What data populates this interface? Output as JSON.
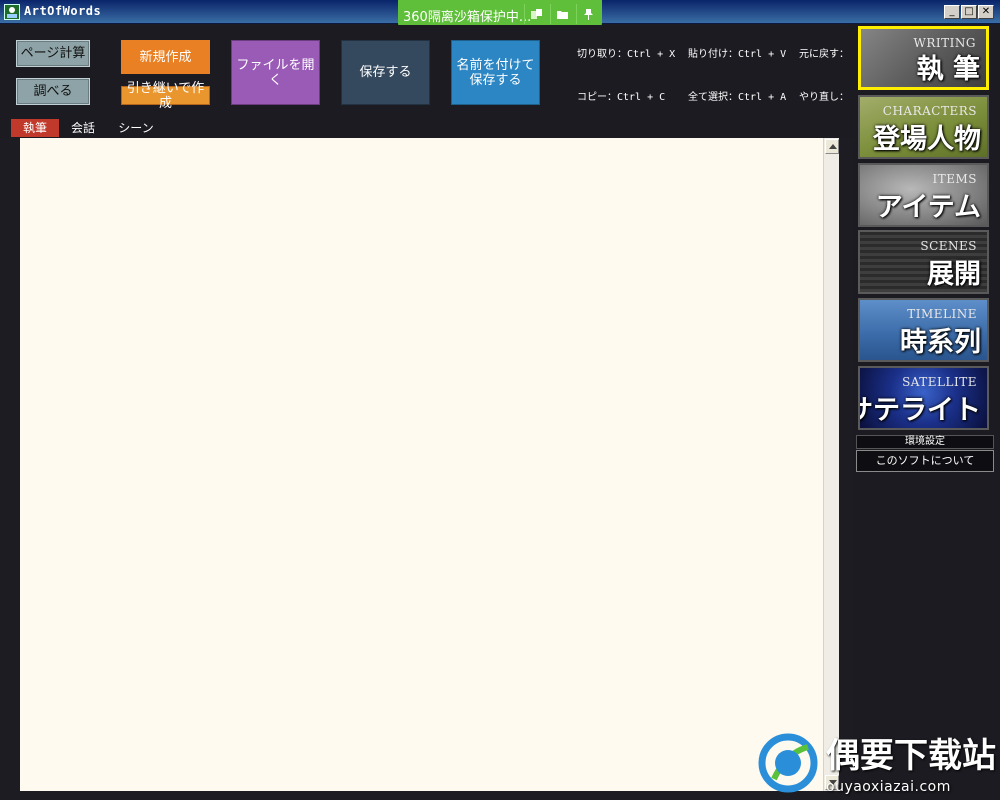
{
  "window": {
    "title": "ArtOfWords",
    "min_label": "_",
    "max_label": "□",
    "close_label": "✕"
  },
  "sandbox": {
    "text": "360隔离沙箱保护中..."
  },
  "toolbar": {
    "page_calc": "ページ計算",
    "lookup": "調べる",
    "new": "新規作成",
    "continue_new": "引き継いで作成",
    "open": "ファイルを開く",
    "save": "保存する",
    "save_as": "名前を付けて\n保存する"
  },
  "shortcuts": {
    "cut": "切り取り：Ctrl + X",
    "paste": "貼り付け：Ctrl + V",
    "undo": "元に戻す：",
    "copy": "コピー：Ctrl + C",
    "select_all": "全て選択：Ctrl + A",
    "redo": "やり直し："
  },
  "tabs": [
    {
      "label": "執筆",
      "active": true
    },
    {
      "label": "会話",
      "active": false
    },
    {
      "label": "シーン",
      "active": false
    }
  ],
  "panel": {
    "tiles": [
      {
        "en": "WRITING",
        "jp": "執 筆",
        "selected": true
      },
      {
        "en": "CHARACTERS",
        "jp": "登場人物",
        "selected": false
      },
      {
        "en": "ITEMS",
        "jp": "アイテム",
        "selected": false
      },
      {
        "en": "SCENES",
        "jp": "展開",
        "selected": false
      },
      {
        "en": "TIMELINE",
        "jp": "時系列",
        "selected": false
      },
      {
        "en": "SATELLITE",
        "jp": "サテライト",
        "selected": false
      }
    ],
    "settings": "環境設定",
    "about": "このソフトについて"
  },
  "watermark": {
    "main": "偶要下载站",
    "sub": "ouyaoxiazai.com"
  },
  "colors": {
    "background": "#1c1c22",
    "editor_bg": "#fefaf0",
    "active_tab": "#c0392b",
    "orange": "#e98023",
    "purple": "#9a5bb7",
    "navy": "#34495e",
    "blue": "#2c86c4",
    "selected_border": "#ffee00",
    "sandbox": "#5fbf3a"
  }
}
